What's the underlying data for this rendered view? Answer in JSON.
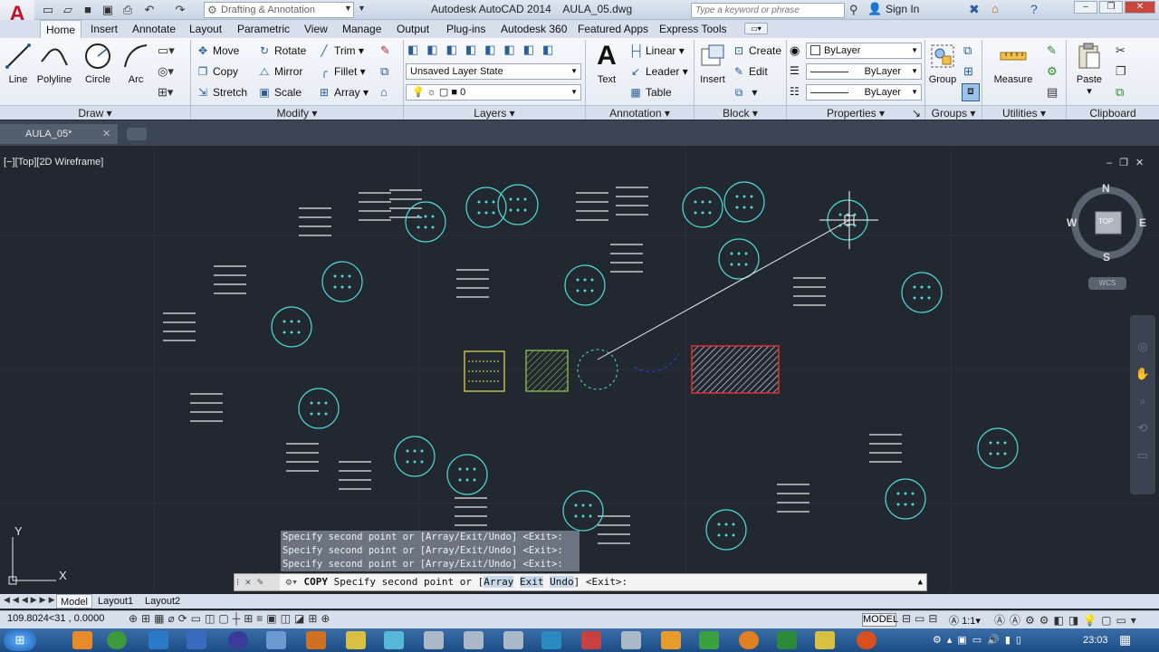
{
  "window": {
    "title": "Autodesk AutoCAD 2014    AULA_05.dwg",
    "workspace": "Drafting & Annotation",
    "search_placeholder": "Type a keyword or phrase",
    "sign_in": "Sign In"
  },
  "ribbon_tabs": [
    "Home",
    "Insert",
    "Annotate",
    "Layout",
    "Parametric",
    "View",
    "Manage",
    "Output",
    "Plug-ins",
    "Autodesk 360",
    "Featured Apps",
    "Express Tools"
  ],
  "draw": {
    "title": "Draw",
    "line": "Line",
    "polyline": "Polyline",
    "circle": "Circle",
    "arc": "Arc"
  },
  "modify": {
    "title": "Modify",
    "move": "Move",
    "rotate": "Rotate",
    "trim": "Trim",
    "copy": "Copy",
    "mirror": "Mirror",
    "fillet": "Fillet",
    "stretch": "Stretch",
    "scale": "Scale",
    "array": "Array"
  },
  "layers": {
    "title": "Layers",
    "state": "Unsaved Layer State",
    "current": "0"
  },
  "annotation": {
    "title": "Annotation",
    "text": "Text",
    "linear": "Linear",
    "leader": "Leader",
    "table": "Table"
  },
  "block": {
    "title": "Block",
    "insert": "Insert",
    "create": "Create",
    "edit": "Edit"
  },
  "properties": {
    "title": "Properties",
    "color": "ByLayer",
    "linetype": "ByLayer",
    "lineweight": "ByLayer"
  },
  "groups": {
    "title": "Groups",
    "group": "Group"
  },
  "utilities": {
    "title": "Utilities",
    "measure": "Measure"
  },
  "clipboard": {
    "title": "Clipboard",
    "paste": "Paste"
  },
  "document": {
    "tab": "AULA_05*",
    "view_label": "[−][Top][2D Wireframe]"
  },
  "viewcube": {
    "n": "N",
    "s": "S",
    "e": "E",
    "w": "W",
    "top": "TOP",
    "wcs": "WCS"
  },
  "ucs": {
    "x": "X",
    "y": "Y"
  },
  "command": {
    "history": [
      "Specify second point or [Array/Exit/Undo] <Exit>:",
      "Specify second point or [Array/Exit/Undo] <Exit>:",
      "Specify second point or [Array/Exit/Undo] <Exit>:"
    ],
    "name": "COPY",
    "prompt": "Specify second point or [",
    "opt1": "Array",
    "opt2": "Exit",
    "opt3": "Undo",
    "tail": "] <Exit>:"
  },
  "layout_tabs": [
    "Model",
    "Layout1",
    "Layout2"
  ],
  "status": {
    "coords": "109.8024<31 , 0.0000",
    "model": "MODEL",
    "scale": "1:1"
  },
  "taskbar": {
    "time": "23:03"
  },
  "colors": {
    "canvas": "#212830",
    "cyan": "#4fd6d6",
    "white": "#e8e8e8",
    "yellow": "#e8e060",
    "green": "#9acd55",
    "red": "#e03030",
    "blue": "#2040c0"
  }
}
